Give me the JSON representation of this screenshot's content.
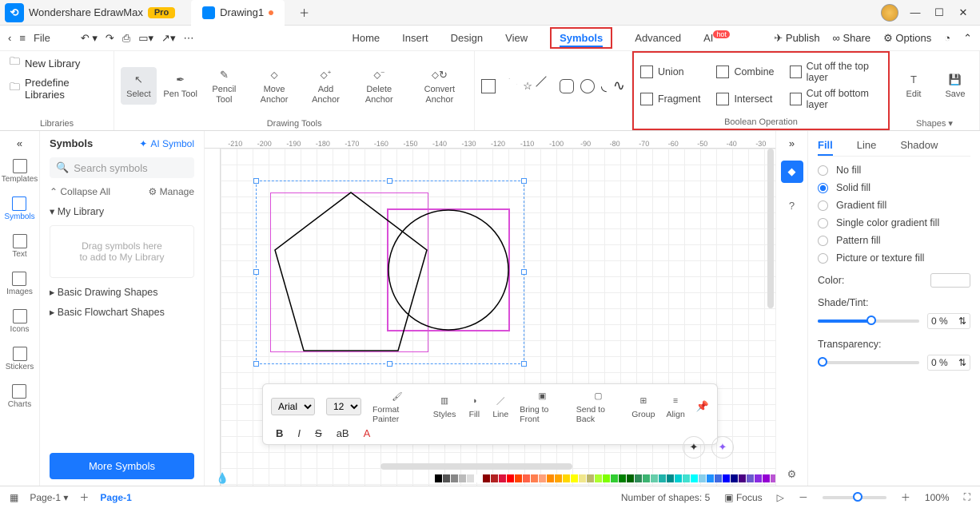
{
  "title_bar": {
    "app_name": "Wondershare EdrawMax",
    "pro": "Pro",
    "tab_name": "Drawing1"
  },
  "menu": {
    "file": "File",
    "items": [
      "Home",
      "Insert",
      "Design",
      "View",
      "Symbols",
      "Advanced",
      "AI"
    ],
    "active": "Symbols",
    "right": {
      "publish": "Publish",
      "share": "Share",
      "options": "Options"
    },
    "hot": "hot"
  },
  "libraries": {
    "new": "New Library",
    "predef": "Predefine Libraries",
    "label": "Libraries"
  },
  "ribbon": {
    "select": "Select",
    "pen": "Pen\nTool",
    "pencil": "Pencil\nTool",
    "move": "Move\nAnchor",
    "add": "Add\nAnchor",
    "del": "Delete\nAnchor",
    "conv": "Convert\nAnchor",
    "drawing_label": "Drawing Tools",
    "bool": {
      "union": "Union",
      "combine": "Combine",
      "cuttop": "Cut off the top layer",
      "fragment": "Fragment",
      "intersect": "Intersect",
      "cutbot": "Cut off bottom layer",
      "label": "Boolean Operation"
    },
    "edit": "Edit",
    "save": "Save",
    "shapes": "Shapes"
  },
  "ruler_ticks": [
    "-210",
    "-200",
    "-190",
    "-180",
    "-170",
    "-160",
    "-150",
    "-140",
    "-130",
    "-120",
    "-110",
    "-100",
    "-90",
    "-80",
    "-70",
    "-60",
    "-50",
    "-40",
    "-30"
  ],
  "left_rail": {
    "templates": "Templates",
    "symbols": "Symbols",
    "text": "Text",
    "images": "Images",
    "icons": "Icons",
    "stickers": "Stickers",
    "charts": "Charts"
  },
  "symbols_panel": {
    "title": "Symbols",
    "ai": "AI Symbol",
    "search_ph": "Search symbols",
    "collapse": "Collapse All",
    "manage": "Manage",
    "mylib": "My Library",
    "dropzone1": "Drag symbols here",
    "dropzone2": "to add to My Library",
    "basic": "Basic Drawing Shapes",
    "flow": "Basic Flowchart Shapes",
    "more": "More Symbols"
  },
  "float_tb": {
    "font": "Arial",
    "size": "12",
    "format": "Format\nPainter",
    "styles": "Styles",
    "fill": "Fill",
    "line": "Line",
    "front": "Bring to\nFront",
    "back": "Send to\nBack",
    "group": "Group",
    "align": "Align"
  },
  "props": {
    "tabs": {
      "fill": "Fill",
      "line": "Line",
      "shadow": "Shadow"
    },
    "nofill": "No fill",
    "solid": "Solid fill",
    "grad": "Gradient fill",
    "single": "Single color gradient fill",
    "pattern": "Pattern fill",
    "pic": "Picture or texture fill",
    "color": "Color:",
    "shade": "Shade/Tint:",
    "trans": "Transparency:",
    "pct": "0 %"
  },
  "status": {
    "page_sel": "Page-1",
    "page_tab": "Page-1",
    "shapes": "Number of shapes: 5",
    "focus": "Focus",
    "zoom": "100%"
  },
  "palette": [
    "#000",
    "#555",
    "#888",
    "#bbb",
    "#ddd",
    "#fff",
    "#8b0000",
    "#b22222",
    "#dc143c",
    "#ff0000",
    "#ff4500",
    "#ff6347",
    "#ff7f50",
    "#ffa07a",
    "#ff8c00",
    "#ffa500",
    "#ffd700",
    "#ffff00",
    "#f0e68c",
    "#bdb76b",
    "#adff2f",
    "#7fff00",
    "#32cd32",
    "#008000",
    "#006400",
    "#2e8b57",
    "#3cb371",
    "#66cdaa",
    "#20b2aa",
    "#008b8b",
    "#00ced1",
    "#40e0d0",
    "#00ffff",
    "#87ceeb",
    "#1e90ff",
    "#4169e1",
    "#0000ff",
    "#00008b",
    "#4b0082",
    "#6a5acd",
    "#8a2be2",
    "#9400d3",
    "#ba55d3",
    "#da70d6",
    "#ff00ff",
    "#c71585",
    "#ff1493",
    "#ff69b4",
    "#a52a2a",
    "#8b4513",
    "#a0522d",
    "#cd853f",
    "#d2b48c"
  ]
}
